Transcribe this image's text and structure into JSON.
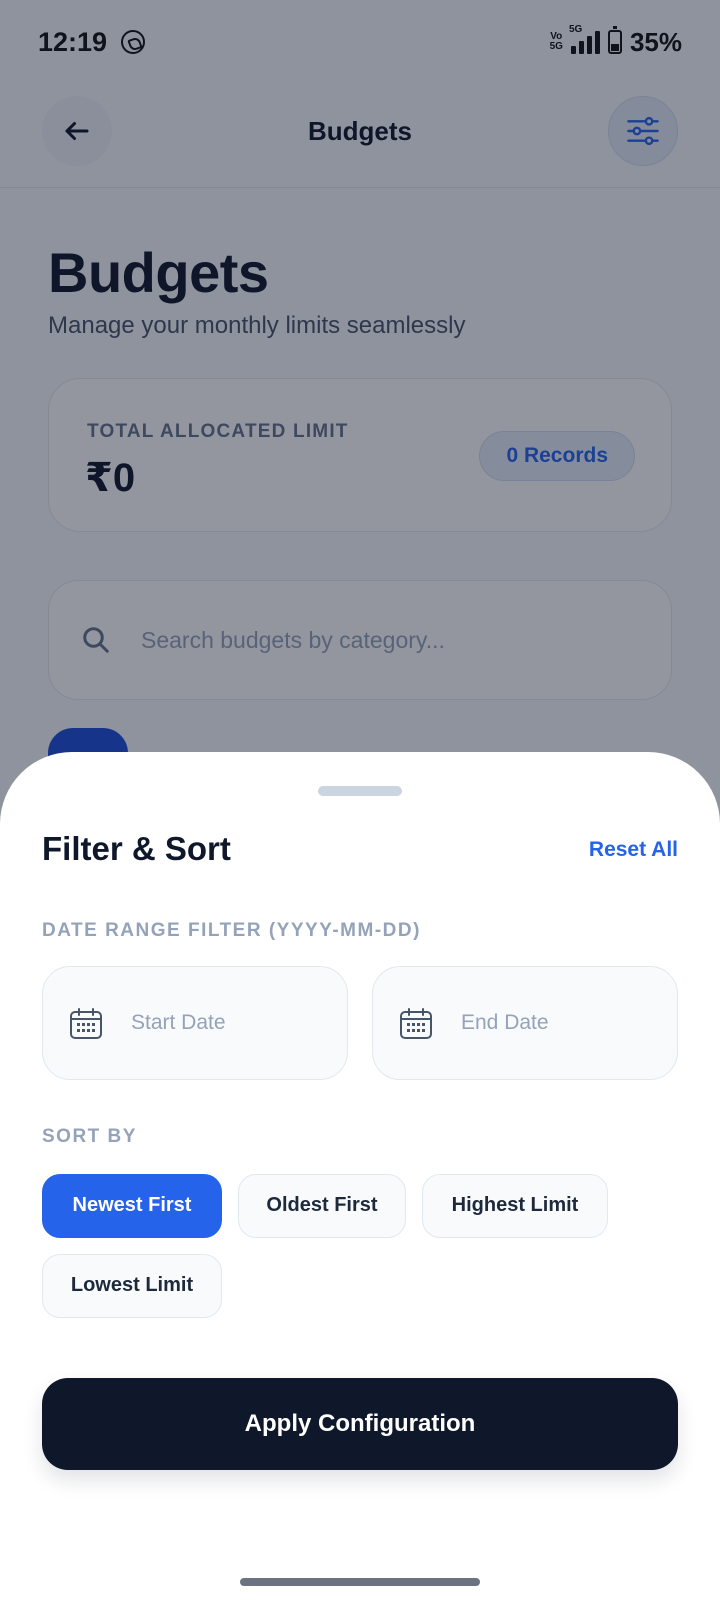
{
  "status_bar": {
    "time": "12:19",
    "network_label": "5G",
    "volte_top": "Vo",
    "volte_bottom": "5G",
    "battery_percent": "35%",
    "battery_level": 0.35
  },
  "header": {
    "title": "Budgets",
    "back_icon": "arrow-left-icon",
    "filter_icon": "sliders-icon"
  },
  "page": {
    "title": "Budgets",
    "subtitle": "Manage your monthly limits seamlessly"
  },
  "summary": {
    "label": "TOTAL ALLOCATED LIMIT",
    "amount": "₹0",
    "records_badge": "0 Records"
  },
  "search": {
    "placeholder": "Search budgets by category...",
    "value": ""
  },
  "sheet": {
    "title": "Filter & Sort",
    "reset_label": "Reset All",
    "date_section_label": "DATE RANGE FILTER (YYYY-MM-DD)",
    "start_date_placeholder": "Start Date",
    "end_date_placeholder": "End Date",
    "sort_section_label": "SORT BY",
    "sort_options": [
      {
        "label": "Newest First",
        "selected": true
      },
      {
        "label": "Oldest First",
        "selected": false
      },
      {
        "label": "Highest Limit",
        "selected": false
      },
      {
        "label": "Lowest Limit",
        "selected": false
      }
    ],
    "apply_label": "Apply Configuration"
  },
  "colors": {
    "accent": "#2563eb",
    "primary_dark": "#0f172a",
    "muted": "#94a3b8"
  }
}
